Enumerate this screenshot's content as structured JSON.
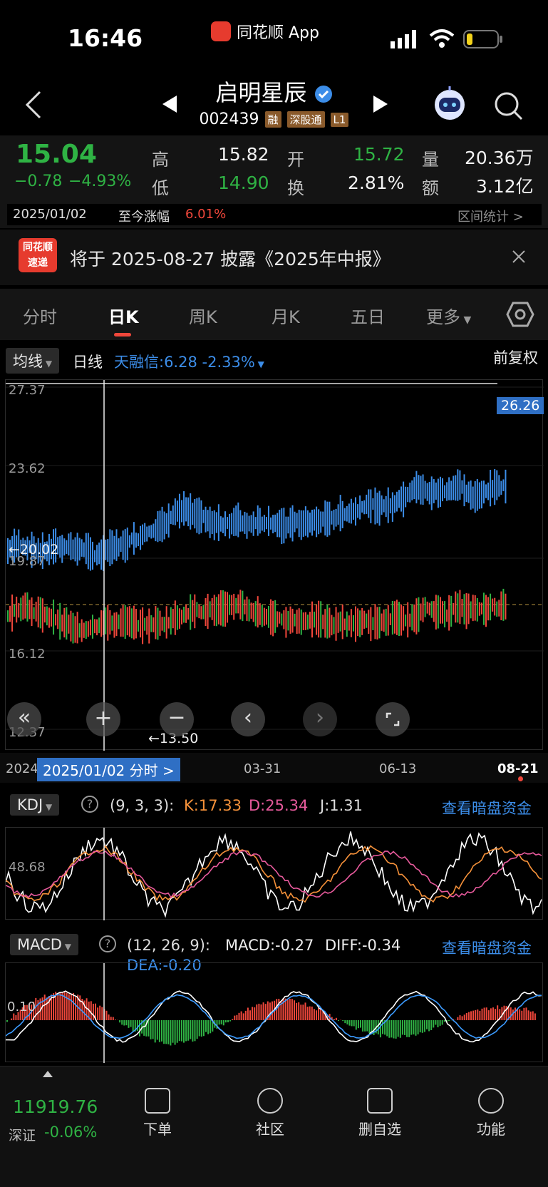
{
  "status_bar": {
    "time": "16:46",
    "app_name": "同花顺 App"
  },
  "nav": {
    "stock_name": "启明星辰",
    "stock_code": "002439",
    "tags": [
      "融",
      "深股通",
      "L1"
    ],
    "icons": [
      "back-icon",
      "prev-stock-icon",
      "next-stock-icon",
      "robot-assistant-icon",
      "search-icon"
    ]
  },
  "quote": {
    "price": "15.04",
    "change": "−0.78",
    "change_pct": "−4.93%",
    "high_label": "高",
    "high": "15.82",
    "open_label": "开",
    "open": "15.72",
    "volume_label": "量",
    "volume": "20.36万",
    "low_label": "低",
    "low": "14.90",
    "turnover_label": "换",
    "turnover": "2.81%",
    "amount_label": "额",
    "amount": "3.12亿",
    "period_date": "2025/01/02",
    "period_label": "至今涨幅",
    "period_change": "6.01%",
    "period_stats": "区间统计 >"
  },
  "notice": {
    "logo_line1": "同花顺",
    "logo_line2": "速递",
    "text": "将于 2025-08-27 披露《2025年中报》"
  },
  "tabs": [
    "分时",
    "日K",
    "周K",
    "月K",
    "五日",
    "更多"
  ],
  "chart_header": {
    "indicator_select": "均线",
    "period": "日线",
    "tianrongxin": "天融信:6.28  -2.33%",
    "adjust": "前复权"
  },
  "kline": {
    "y_labels": [
      "27.37",
      "23.62",
      "19.87",
      "16.12",
      "12.37"
    ],
    "price_tag": "26.26",
    "max_marker": "←20.02",
    "min_marker": "←13.50",
    "x_labels": [
      "2024",
      "03-31",
      "06-13",
      "08-21"
    ],
    "cursor_date": "2025/01/02 分时 >"
  },
  "kdj": {
    "name": "KDJ",
    "params": "(9, 3, 3):",
    "k": "K:17.33",
    "d": "D:25.34",
    "j": "J:1.31",
    "link": "查看暗盘资金",
    "mid_label": "48.68"
  },
  "macd": {
    "name": "MACD",
    "params": "(12, 26, 9):",
    "macd": "MACD:-0.27",
    "diff": "DIFF:-0.34",
    "dea": "DEA:-0.20",
    "link": "查看暗盘资金",
    "mid_label": "0.10"
  },
  "bottom": {
    "index_value": "11919.76",
    "index_name": "深证",
    "index_change": "-0.06%",
    "buttons": [
      "下单",
      "社区",
      "删自选",
      "功能"
    ]
  },
  "colors": {
    "up": "#f0473b",
    "down": "#2fb344",
    "accent": "#3c8de8",
    "bg": "#000000"
  }
}
